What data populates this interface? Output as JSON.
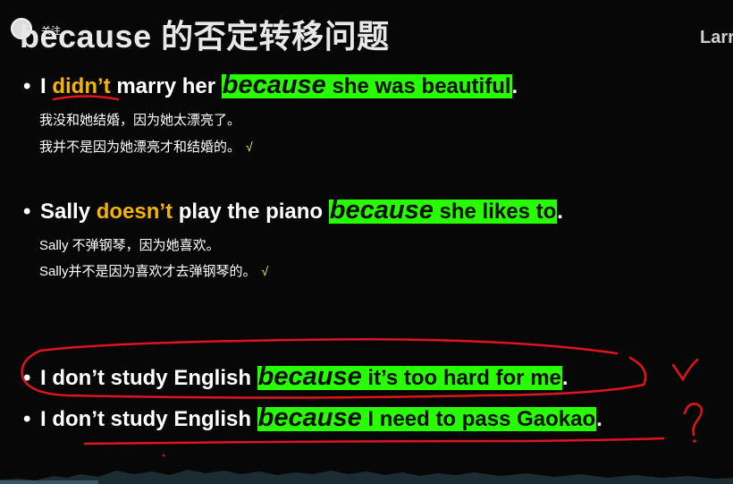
{
  "title": "because 的否定转移问题",
  "corner_text": "Larr",
  "logo_text": "关注",
  "sentences": [
    {
      "bullet": "•",
      "pre": "I ",
      "neg": "didn’t",
      "mid": " marry her ",
      "because": "because",
      "clause": " she was beautiful",
      "end": ".",
      "translations": [
        "我没和她结婚，因为她太漂亮了。",
        "我并不是因为她漂亮才和结婚的。"
      ],
      "check": "√"
    },
    {
      "bullet": "•",
      "pre": "Sally ",
      "neg": "doesn’t",
      "mid": " play the piano ",
      "because": "because",
      "clause": " she likes to",
      "end": ".",
      "translations": [
        "Sally 不弹钢琴，因为她喜欢。",
        "Sally并不是因为喜欢才去弹钢琴的。"
      ],
      "check": "√"
    },
    {
      "bullet": "•",
      "pre": "I don’t study English ",
      "because": "because",
      "clause": " it’s too hard for me",
      "end": "."
    },
    {
      "bullet": "•",
      "pre": "I don’t study English ",
      "because": "because",
      "clause": " I need to pass Gaokao",
      "end": "."
    }
  ],
  "colors": {
    "highlight": "#27ff00",
    "negation": "#f5b400",
    "ink": "#e0141e",
    "check": "#ffef6a"
  }
}
